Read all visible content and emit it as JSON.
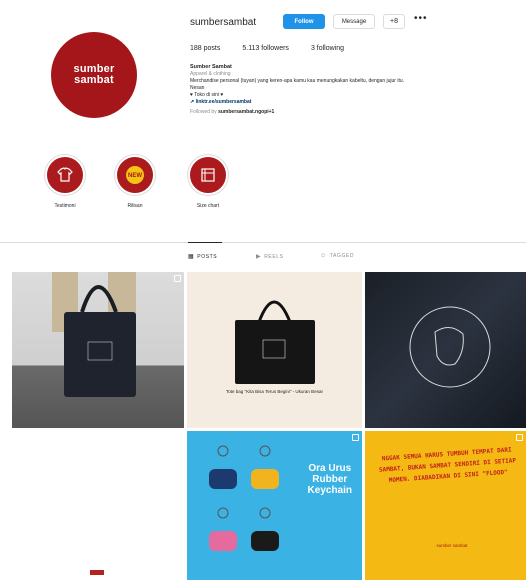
{
  "profile": {
    "avatar_line1": "sumber",
    "avatar_line2": "sambat",
    "username": "sumbersambat",
    "follow_label": "Follow",
    "message_label": "Message",
    "more_label": "•••",
    "suggest_label": "+8",
    "stats": {
      "posts": "188 posts",
      "followers": "5.113 followers",
      "following": "3 following"
    },
    "bio": {
      "name": "Sumber Sambat",
      "category": "Apparel & clothing",
      "line1": "Merchandise personal (tuyan) yang keren-apa kamu kau menungkakan kabeltu, dengan jujur itu.",
      "line2": "Nesan",
      "line3": "♥ Toko di sini ♥",
      "link": "↗ linktr.ee/sumbersambat",
      "followed_prefix": "Followed by",
      "followed_by": "sumbersambat.ngopi+1"
    }
  },
  "highlights": [
    {
      "label": "Testimoni",
      "icon": "shirt-icon"
    },
    {
      "label": "Rilisan",
      "icon": "new-badge-icon"
    },
    {
      "label": "Size chart",
      "icon": "size-chart-icon"
    }
  ],
  "tabs": [
    {
      "label": "POSTS",
      "icon": "grid-icon",
      "active": true
    },
    {
      "label": "REELS",
      "icon": "reels-icon",
      "active": false
    },
    {
      "label": "TAGGED",
      "icon": "tagged-icon",
      "active": false
    }
  ],
  "posts": [
    {
      "kind": "photo",
      "description_visible": "",
      "multi": true
    },
    {
      "kind": "photo",
      "caption": "Tote bag \"Kita Bisa Terus Begini\" - Ukuran Besar",
      "multi": false
    },
    {
      "kind": "photo",
      "multi": false
    },
    {
      "kind": "photo",
      "multi": false
    },
    {
      "kind": "graphic",
      "title_line1": "Ora Urus",
      "title_line2": "Rubber",
      "title_line3": "Keychain",
      "multi": true
    },
    {
      "kind": "graphic",
      "quote": "NGGAK SEMUA HARUS TUMBUH TEMPAT DARI SAMBAT, BUKAN SAMBAT SENDIRI DI SETIAP MOMEN. DIABADIKAN DI SINI \"FLOOD\"",
      "signature": "sumber sambat",
      "multi": true
    }
  ],
  "colors": {
    "brand_red": "#a5161a",
    "follow_blue": "#1f93e8"
  }
}
